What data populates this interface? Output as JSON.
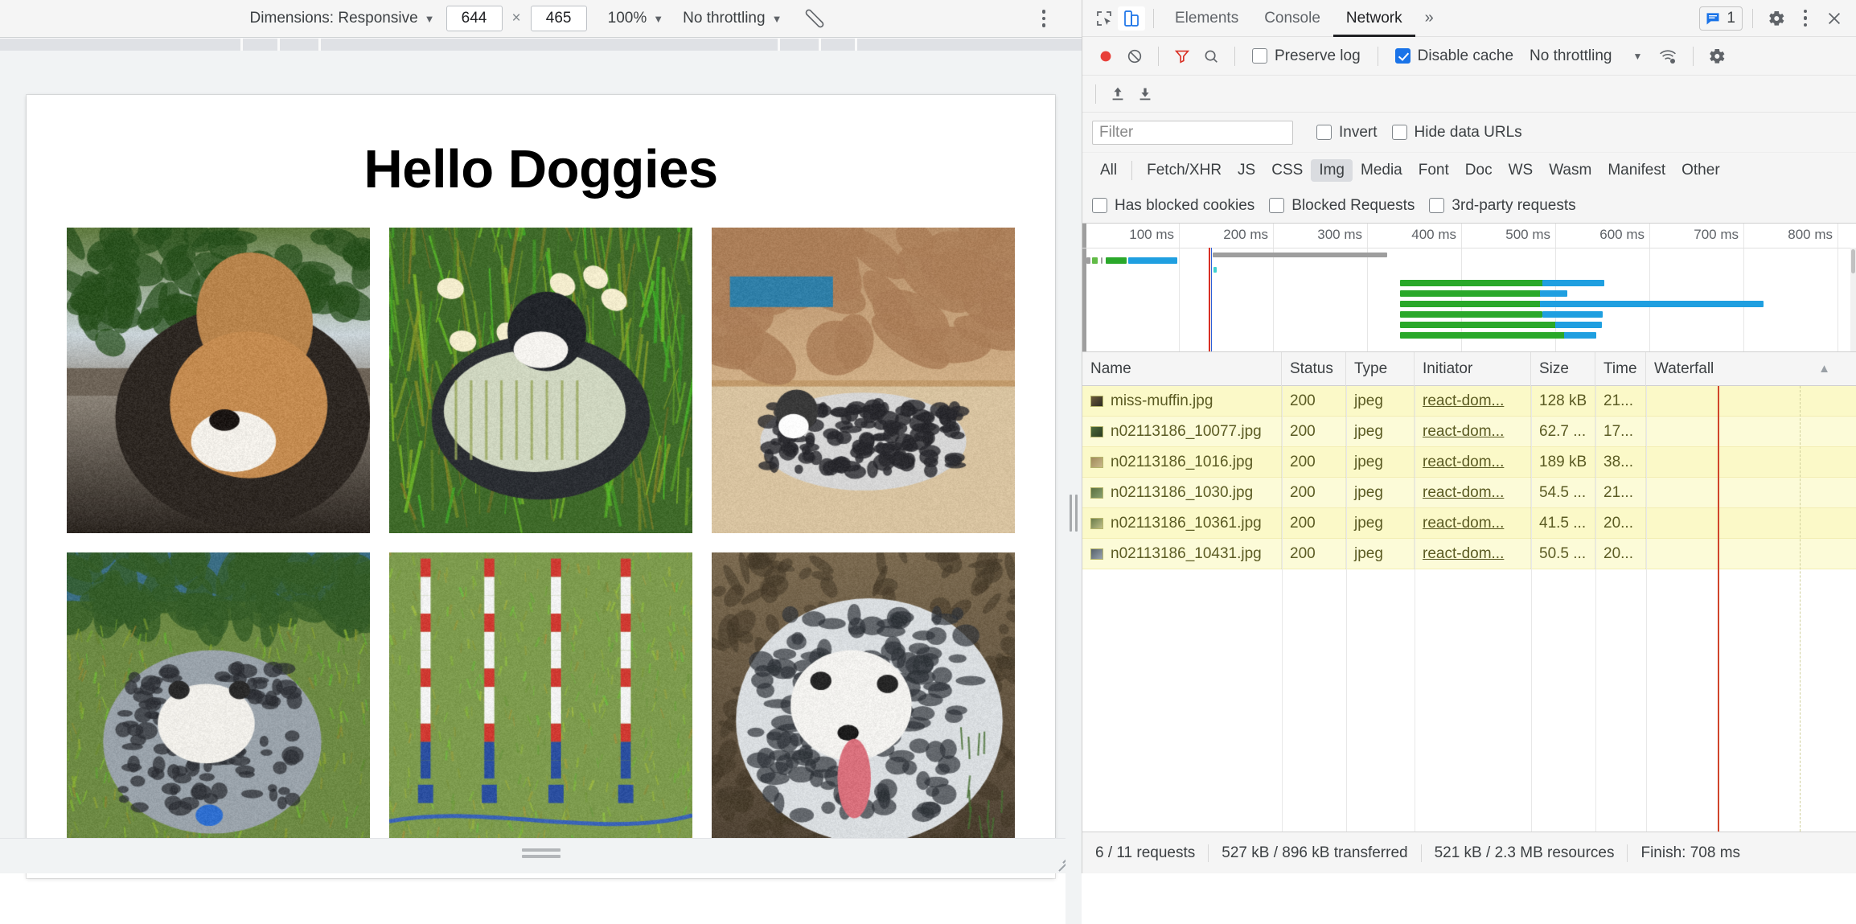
{
  "device_toolbar": {
    "dimensions_label": "Dimensions: Responsive",
    "width_value": "644",
    "height_value": "465",
    "multiply_symbol": "×",
    "zoom_label": "100%",
    "throttling_label": "No throttling",
    "rotate_icon": "rotate-device-icon",
    "more_icon": "more-options-icon"
  },
  "page": {
    "heading": "Hello Doggies",
    "images": [
      {
        "name": "miss-muffin.jpg",
        "alt": "Corgi with tan and black fur sitting on a wooden deck"
      },
      {
        "name": "n02113186_10077.jpg",
        "alt": "Cardigan corgi in a knitted sweater among daffodils"
      },
      {
        "name": "n02113186_1016.jpg",
        "alt": "Blue merle corgi lying on sandy ground by red rocks"
      },
      {
        "name": "n02113186_1030.jpg",
        "alt": "Blue merle corgi puppy lying on grass"
      },
      {
        "name": "n02113186_10361.jpg",
        "alt": "Agility weave poles on a green lawn"
      },
      {
        "name": "n02113186_10431.jpg",
        "alt": "Blue merle corgi with tongue out lying in dirt"
      }
    ]
  },
  "devtools": {
    "tabs": [
      {
        "label": "Elements",
        "selected": false
      },
      {
        "label": "Console",
        "selected": false
      },
      {
        "label": "Network",
        "selected": true
      }
    ],
    "more_tabs_icon": "chevron-double-right-icon",
    "inspect_icon": "inspect-element-icon",
    "device_toggle_icon": "toggle-device-toolbar-icon",
    "issues_count": "1",
    "issues_icon": "issues-message-icon",
    "settings_icon": "gear-icon",
    "main_menu_icon": "more-options-icon",
    "close_icon": "close-icon",
    "network_toolbar": {
      "record_icon": "record-stop-icon",
      "clear_icon": "clear-icon",
      "filter_icon": "filter-funnel-icon",
      "search_icon": "search-icon",
      "preserve_log_label": "Preserve log",
      "preserve_log_checked": false,
      "disable_cache_label": "Disable cache",
      "disable_cache_checked": true,
      "throttling_label": "No throttling",
      "network_conditions_icon": "wifi-settings-icon",
      "settings_icon": "gear-icon",
      "import_icon": "import-har-icon",
      "export_icon": "export-har-icon"
    },
    "filter_bar": {
      "filter_placeholder": "Filter",
      "filter_value": "",
      "invert_label": "Invert",
      "invert_checked": false,
      "hide_data_urls_label": "Hide data URLs",
      "hide_data_urls_checked": false
    },
    "resource_types": [
      {
        "label": "All",
        "selected": false
      },
      {
        "label": "Fetch/XHR",
        "selected": false
      },
      {
        "label": "JS",
        "selected": false
      },
      {
        "label": "CSS",
        "selected": false
      },
      {
        "label": "Img",
        "selected": true
      },
      {
        "label": "Media",
        "selected": false
      },
      {
        "label": "Font",
        "selected": false
      },
      {
        "label": "Doc",
        "selected": false
      },
      {
        "label": "WS",
        "selected": false
      },
      {
        "label": "Wasm",
        "selected": false
      },
      {
        "label": "Manifest",
        "selected": false
      },
      {
        "label": "Other",
        "selected": false
      }
    ],
    "extra_filters": [
      {
        "label": "Has blocked cookies",
        "checked": false
      },
      {
        "label": "Blocked Requests",
        "checked": false
      },
      {
        "label": "3rd-party requests",
        "checked": false
      }
    ],
    "overview": {
      "tick_labels": [
        "100 ms",
        "200 ms",
        "300 ms",
        "400 ms",
        "500 ms",
        "600 ms",
        "700 ms",
        "800 ms"
      ]
    },
    "table": {
      "columns": [
        "Name",
        "Status",
        "Type",
        "Initiator",
        "Size",
        "Time",
        "Waterfall"
      ],
      "sort_icon": "sort-ascending-icon",
      "rows": [
        {
          "name": "miss-muffin.jpg",
          "status": "200",
          "type": "jpeg",
          "initiator": "react-dom...",
          "size": "128 kB",
          "time": "21..."
        },
        {
          "name": "n02113186_10077.jpg",
          "status": "200",
          "type": "jpeg",
          "initiator": "react-dom...",
          "size": "62.7 ...",
          "time": "17..."
        },
        {
          "name": "n02113186_1016.jpg",
          "status": "200",
          "type": "jpeg",
          "initiator": "react-dom...",
          "size": "189 kB",
          "time": "38..."
        },
        {
          "name": "n02113186_1030.jpg",
          "status": "200",
          "type": "jpeg",
          "initiator": "react-dom...",
          "size": "54.5 ...",
          "time": "21..."
        },
        {
          "name": "n02113186_10361.jpg",
          "status": "200",
          "type": "jpeg",
          "initiator": "react-dom...",
          "size": "41.5 ...",
          "time": "20..."
        },
        {
          "name": "n02113186_10431.jpg",
          "status": "200",
          "type": "jpeg",
          "initiator": "react-dom...",
          "size": "50.5 ...",
          "time": "20..."
        }
      ]
    },
    "status_bar": {
      "requests": "6 / 11 requests",
      "transferred": "527 kB / 896 kB transferred",
      "resources": "521 kB / 2.3 MB resources",
      "finish": "Finish: 708 ms"
    }
  },
  "colors": {
    "accent": "#1a73e8",
    "record": "#e8403a",
    "row_highlight": "#fbf9c8",
    "waterfall_green": "#61bb46",
    "waterfall_teal": "#62c2c2",
    "waterfall_blue": "#1f7ae0",
    "red_marker": "#d93025"
  }
}
